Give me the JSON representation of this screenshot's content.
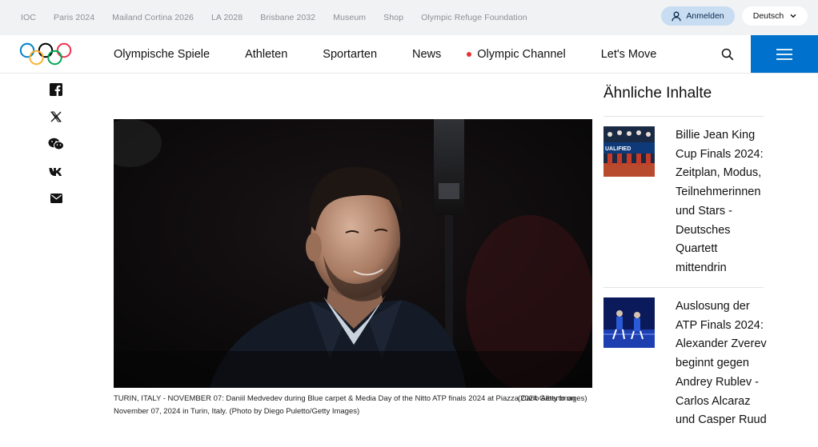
{
  "topbar": {
    "links": [
      "IOC",
      "Paris 2024",
      "Mailand Cortina 2026",
      "LA 2028",
      "Brisbane 2032",
      "Museum",
      "Shop",
      "Olympic Refuge Foundation"
    ],
    "login_label": "Anmelden",
    "language": "Deutsch"
  },
  "nav": {
    "items": [
      "Olympische Spiele",
      "Athleten",
      "Sportarten",
      "News",
      "Olympic Channel",
      "Let's Move"
    ]
  },
  "share": {
    "icons": [
      "facebook-icon",
      "x-icon",
      "wechat-icon",
      "vk-icon",
      "email-icon"
    ]
  },
  "article": {
    "caption": "TURIN, ITALY - NOVEMBER 07: Daniil Medvedev during Blue carpet & Media Day of the Nitto ATP finals 2024 at Piazza Carlo Alberto on November 07, 2024 in Turin, Italy. (Photo by Diego Puletto/Getty Images)",
    "credit": "(2024 Getty Images)"
  },
  "related": {
    "title": "Ähnliche Inhalte",
    "items": [
      {
        "title": "Billie Jean King Cup Finals 2024: Zeitplan, Modus, Teilnehmerinnen und Stars - Deutsches Quartett mittendrin",
        "thumb_text": "UALIFIED"
      },
      {
        "title": "Auslosung der ATP Finals 2024: Alexander Zverev beginnt gegen Andrey Rublev - Carlos Alcaraz und Casper Ruud"
      }
    ]
  },
  "colors": {
    "accent_blue": "#0072ce",
    "login_bg": "#c8dcf2",
    "live_dot": "#e8322d",
    "topbar_bg": "#f1f2f4"
  }
}
